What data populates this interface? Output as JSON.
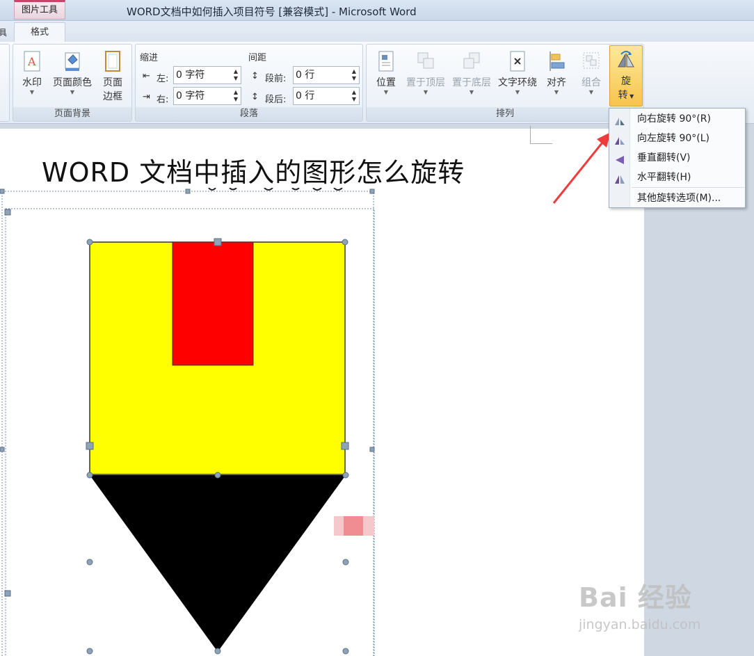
{
  "titlebar": {
    "context_tab": "图片工具",
    "window_title": "WORD文档中如何插入项目符号 [兼容模式] - Microsoft Word"
  },
  "tabs": {
    "edge_tab": "具",
    "format": "格式"
  },
  "ribbon": {
    "page_background": {
      "label": "页面背景",
      "watermark": "水印",
      "page_color": "页面颜色",
      "page_border_line1": "页面",
      "page_border_line2": "边框"
    },
    "paragraph": {
      "label": "段落",
      "indent_title": "缩进",
      "spacing_title": "间距",
      "left_label": "左:",
      "left_value": "0 字符",
      "right_label": "右:",
      "right_value": "0 字符",
      "before_label": "段前:",
      "before_value": "0 行",
      "after_label": "段后:",
      "after_value": "0 行"
    },
    "arrange": {
      "label": "排列",
      "position": "位置",
      "bring_front": "置于顶层",
      "send_back": "置于底层",
      "wrap_text": "文字环绕",
      "align": "对齐",
      "group": "组合",
      "rotate_line1": "旋",
      "rotate_line2": "转"
    }
  },
  "rotate_menu": {
    "items": [
      {
        "label": "向右旋转 90°(R)",
        "icon": "rotate-right-icon"
      },
      {
        "label": "向左旋转 90°(L)",
        "icon": "rotate-left-icon"
      },
      {
        "label": "垂直翻转(V)",
        "icon": "flip-vertical-icon"
      },
      {
        "label": "水平翻转(H)",
        "icon": "flip-horizontal-icon"
      },
      {
        "label": "其他旋转选项(M)...",
        "icon": ""
      }
    ]
  },
  "document": {
    "heading": "WORD 文档中插入的图形怎么旋转"
  },
  "watermark": {
    "brand": "Bai 经验",
    "url": "jingyan.baidu.com"
  },
  "colors": {
    "shape_yellow": "#ffff00",
    "shape_red": "#ff0000",
    "shape_black": "#000000",
    "arrow_red": "#ee3b3b",
    "rotate_highlight": "#f7c44c"
  }
}
